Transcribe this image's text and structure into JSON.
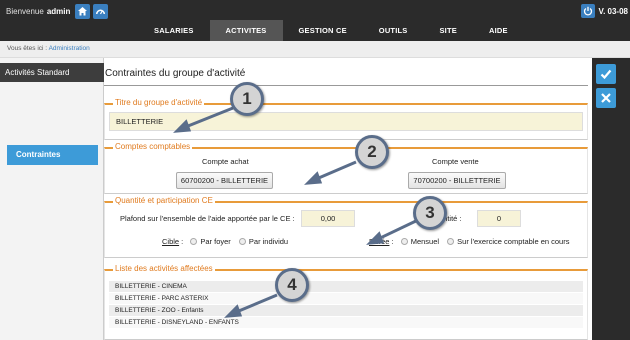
{
  "header": {
    "welcome_label": "Bienvenue",
    "username": "admin",
    "version": "V. 03-08",
    "icons": [
      "home-icon",
      "dashboard-icon",
      "power-icon"
    ],
    "nav": [
      {
        "label": "SALARIES",
        "active": false
      },
      {
        "label": "ACTIVITES",
        "active": true
      },
      {
        "label": "GESTION CE",
        "active": false
      },
      {
        "label": "OUTILS",
        "active": false
      },
      {
        "label": "SITE",
        "active": false
      },
      {
        "label": "AIDE",
        "active": false
      }
    ]
  },
  "breadcrumb": {
    "prefix": "Vous êtes ici :",
    "link": "Administration"
  },
  "sidebar": {
    "heading": "Activités Standard",
    "items": [
      {
        "label": "Contraintes",
        "active": true
      }
    ]
  },
  "actions": {
    "icons": [
      "check-icon",
      "close-icon"
    ],
    "accent": "#3d9bd8"
  },
  "main": {
    "title": "Contraintes du groupe d'activité",
    "sections": {
      "titre": {
        "legend": "Titre du groupe d'activité",
        "value": "BILLETTERIE"
      },
      "comptes": {
        "legend": "Comptes comptables",
        "achat_label": "Compte achat",
        "achat_value": "60700200 - BILLETTERIE",
        "vente_label": "Compte vente",
        "vente_value": "70700200 - BILLETTERIE"
      },
      "quantite": {
        "legend": "Quantité et participation CE",
        "plafond_label": "Plafond sur l'ensemble de l'aide apportée par le CE :",
        "plafond_value": "0,00",
        "quantite_label": "Quantité :",
        "quantite_value": "0",
        "cible_label": "Cible",
        "cible_options": [
          "Par foyer",
          "Par individu"
        ],
        "duree_label": "Durée",
        "duree_options": [
          "Mensuel",
          "Sur l'exercice comptable en cours"
        ]
      },
      "liste": {
        "legend": "Liste des activités affectées",
        "items": [
          "BILLETTERIE - CINEMA",
          "BILLETTERIE - PARC ASTERIX",
          "BILLETTERIE - ZOO - Enfants",
          "BILLETTERIE - DISNEYLAND - ENFANTS"
        ]
      }
    }
  },
  "callouts": [
    "1",
    "2",
    "3",
    "4"
  ],
  "colors": {
    "topbar": "#2b2b2b",
    "accent_blue": "#3d9bd8",
    "legend_orange": "#e07b1f",
    "field_yellow": "#f7f3d8"
  }
}
